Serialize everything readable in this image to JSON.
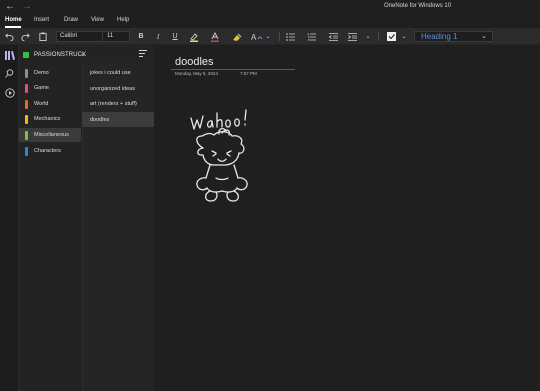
{
  "app": {
    "title": "OneNote for Windows 10"
  },
  "menu": {
    "items": [
      "Home",
      "Insert",
      "Draw",
      "View",
      "Help"
    ],
    "active": "Home"
  },
  "toolbar": {
    "font_name": "Calibri",
    "font_size": "11",
    "bold_label": "B",
    "italic_label": "I",
    "underline_label": "U",
    "style_value": "Heading 1"
  },
  "notebook": {
    "name": "PASSIONSTRUCK",
    "color": "#3bba3e"
  },
  "sections": [
    {
      "label": "Demo",
      "color": "#8d8d8d"
    },
    {
      "label": "Game",
      "color": "#e84a8b"
    },
    {
      "label": "World",
      "color": "#e86a2a"
    },
    {
      "label": "Mechanics",
      "color": "#f2b51c"
    },
    {
      "label": "Miscellaneous",
      "color": "#7fc43a"
    },
    {
      "label": "Characters",
      "color": "#2f86d8"
    }
  ],
  "selected_section": "Miscellaneous",
  "pages": [
    {
      "label": "jokes i could use"
    },
    {
      "label": "unorganized ideas"
    },
    {
      "label": "art (renders + stuff)"
    },
    {
      "label": "doodles"
    }
  ],
  "selected_page": "doodles",
  "note": {
    "title": "doodles",
    "date": "Monday, May 6, 2024",
    "time": "7:57 PM",
    "doodle_text": "Wahoo!"
  }
}
